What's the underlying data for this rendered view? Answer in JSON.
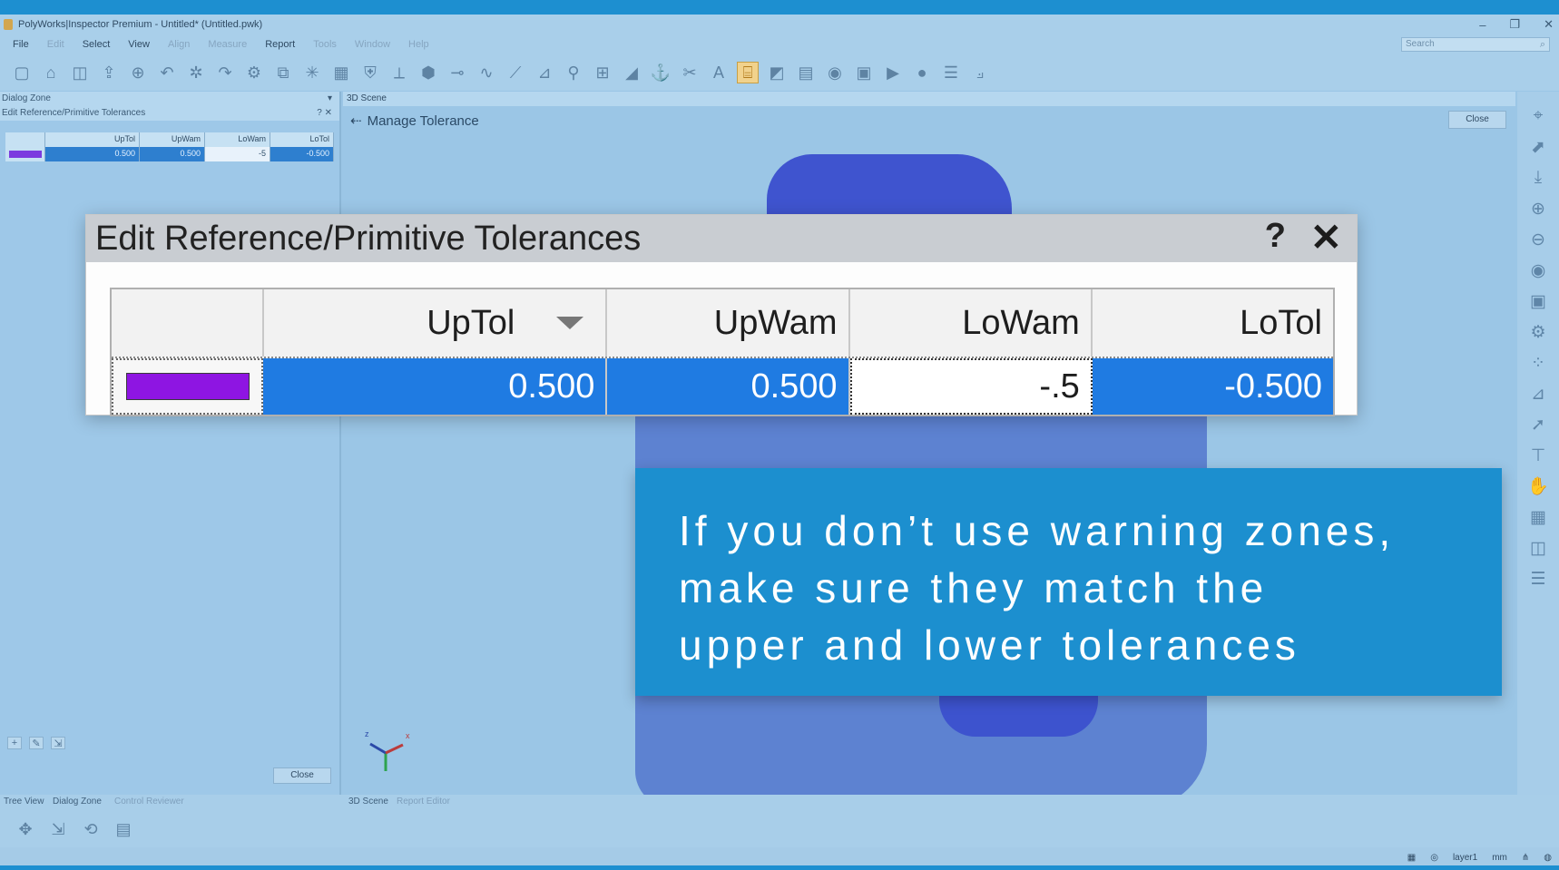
{
  "window": {
    "title": "PolyWorks|Inspector Premium - Untitled* (Untitled.pwk)",
    "controls": [
      "–",
      "❐",
      "✕"
    ]
  },
  "menu": {
    "items": [
      {
        "label": "File",
        "enabled": true
      },
      {
        "label": "Edit",
        "enabled": false
      },
      {
        "label": "Select",
        "enabled": true
      },
      {
        "label": "View",
        "enabled": true
      },
      {
        "label": "Align",
        "enabled": false
      },
      {
        "label": "Measure",
        "enabled": false
      },
      {
        "label": "Report",
        "enabled": true
      },
      {
        "label": "Tools",
        "enabled": false
      },
      {
        "label": "Window",
        "enabled": false
      },
      {
        "label": "Help",
        "enabled": false
      }
    ],
    "search_placeholder": "Search"
  },
  "toolbar": {
    "icons": [
      "new-file-icon",
      "open-folder-icon",
      "save-icon",
      "export-icon",
      "globe-icon",
      "undo-icon",
      "shape-icon",
      "redo-icon",
      "settings-icon",
      "copy-icon",
      "sparkle-icon",
      "grid-icon",
      "shield-icon",
      "measure-icon",
      "cube-icon",
      "probe-icon",
      "curve-icon",
      "line-icon",
      "graph-icon",
      "zoom-icon",
      "frame-icon",
      "chart-icon",
      "anchor-icon",
      "clip-icon",
      "text-icon",
      "tolerance-icon",
      "map-icon",
      "table-icon",
      "camera-icon",
      "report-icon",
      "play-icon",
      "record-icon",
      "layers-icon",
      "plot-icon"
    ]
  },
  "dialog_zone": {
    "title": "Dialog Zone",
    "subtitle": "Edit Reference/Primitive Tolerances",
    "help": "?",
    "close": "✕",
    "table": {
      "headers": [
        "",
        "UpTol",
        "UpWam",
        "LoWam",
        "LoTol"
      ],
      "row": [
        "",
        "0.500",
        "0.500",
        "-5",
        "-0.500"
      ]
    },
    "close_button": "Close"
  },
  "scene": {
    "title": "3D Scene",
    "manage_label": "Manage Tolerance",
    "close_button": "Close"
  },
  "zoom_dialog": {
    "title": "Edit Reference/Primitive Tolerances",
    "help": "?",
    "close": "✕",
    "headers": [
      "",
      "UpTol",
      "UpWam",
      "LoWam",
      "LoTol"
    ],
    "row": {
      "color": "#8e15e2",
      "uptol": "0.500",
      "upwam": "0.500",
      "lowam": "-.5",
      "lotol": "-0.500"
    }
  },
  "caption": {
    "lines": [
      "If you don’t use warning zones,",
      "make sure they match the",
      "upper and lower tolerances"
    ]
  },
  "right_toolbar": {
    "icons": [
      "capture-icon",
      "pick-icon",
      "download-icon",
      "zoom-in-icon",
      "zoom-fit-icon",
      "eye-icon",
      "box-icon",
      "camera-settings-icon",
      "points-icon",
      "align-icon",
      "arrow-icon",
      "section-icon",
      "hand-icon",
      "grid-view-icon",
      "dialog-icon",
      "layer-icon"
    ]
  },
  "bottom_tabs": {
    "left": [
      "Tree View",
      "Dialog Zone",
      "Control Reviewer"
    ],
    "right": [
      "3D Scene",
      "Report Editor"
    ]
  },
  "status": {
    "layer": "layer1",
    "units": "mm"
  },
  "axis": {
    "z": "z",
    "x": "x"
  }
}
